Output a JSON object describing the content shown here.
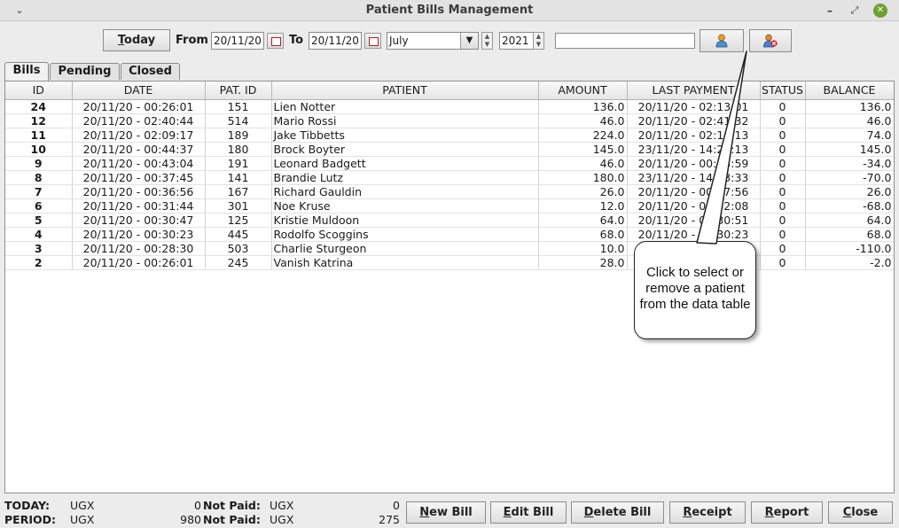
{
  "window": {
    "title": "Patient Bills Management"
  },
  "toolbar": {
    "today_label": "Today",
    "from_label": "From",
    "from_date": "20/11/20",
    "to_label": "To",
    "to_date": "20/11/20",
    "month": "July",
    "year": "2021",
    "search_value": ""
  },
  "tabs": [
    "Bills",
    "Pending",
    "Closed"
  ],
  "table": {
    "headers": [
      "ID",
      "DATE",
      "PAT. ID",
      "PATIENT",
      "AMOUNT",
      "LAST PAYMENT",
      "STATUS",
      "BALANCE"
    ],
    "rows": [
      [
        "24",
        "20/11/20 - 00:26:01",
        "151",
        "Lien Notter",
        "136.0",
        "20/11/20 - 02:13:01",
        "0",
        "136.0"
      ],
      [
        "12",
        "20/11/20 - 02:40:44",
        "514",
        "Mario Rossi",
        "46.0",
        "20/11/20 - 02:41:32",
        "0",
        "46.0"
      ],
      [
        "11",
        "20/11/20 - 02:09:17",
        "189",
        "Jake Tibbetts",
        "224.0",
        "20/11/20 - 02:10:13",
        "0",
        "74.0"
      ],
      [
        "10",
        "20/11/20 - 00:44:37",
        "180",
        "Brock Boyter",
        "145.0",
        "23/11/20 - 14:21:13",
        "0",
        "145.0"
      ],
      [
        "9",
        "20/11/20 - 00:43:04",
        "191",
        "Leonard Badgett",
        "46.0",
        "20/11/20 - 00:43:59",
        "0",
        "-34.0"
      ],
      [
        "8",
        "20/11/20 - 00:37:45",
        "141",
        "Brandie Lutz",
        "180.0",
        "23/11/20 - 14:23:33",
        "0",
        "-70.0"
      ],
      [
        "7",
        "20/11/20 - 00:36:56",
        "167",
        "Richard Gauldin",
        "26.0",
        "20/11/20 - 00:37:56",
        "0",
        "26.0"
      ],
      [
        "6",
        "20/11/20 - 00:31:44",
        "301",
        "Noe Kruse",
        "12.0",
        "20/11/20 - 00:32:08",
        "0",
        "-68.0"
      ],
      [
        "5",
        "20/11/20 - 00:30:47",
        "125",
        "Kristie Muldoon",
        "64.0",
        "20/11/20 - 00:30:51",
        "0",
        "64.0"
      ],
      [
        "4",
        "20/11/20 - 00:30:23",
        "445",
        "Rodolfo Scoggins",
        "68.0",
        "20/11/20 - 00:30:23",
        "0",
        "68.0"
      ],
      [
        "3",
        "20/11/20 - 00:28:30",
        "503",
        "Charlie Sturgeon",
        "10.0",
        "",
        "0",
        "-110.0"
      ],
      [
        "2",
        "20/11/20 - 00:26:01",
        "245",
        "Vanish Katrina",
        "28.0",
        "",
        "0",
        "-2.0"
      ]
    ]
  },
  "callout": {
    "text": "Click to select or remove a patient from the data table"
  },
  "footer": {
    "today_label": "TODAY:",
    "period_label": "PERIOD:",
    "currency": "UGX",
    "today_value": "0",
    "period_value": "980",
    "not_paid_label": "Not Paid:",
    "today_not_paid": "0",
    "period_not_paid": "275"
  },
  "buttons": {
    "new_bill": "New Bill",
    "edit_bill": "Edit Bill",
    "delete_bill": "Delete Bill",
    "receipt": "Receipt",
    "report": "Report",
    "close": "Close"
  }
}
